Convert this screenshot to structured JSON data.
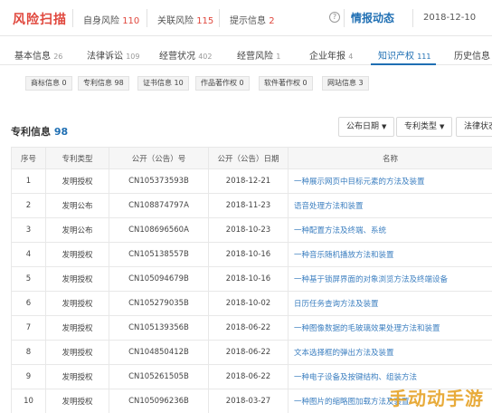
{
  "header": {
    "logo": "风险扫描",
    "self_risk_label": "自身风险",
    "self_risk_count": "110",
    "related_risk_label": "关联风险",
    "related_risk_count": "115",
    "hint_label": "提示信息",
    "hint_count": "2",
    "help_icon": "?",
    "news_label": "情报动态",
    "date": "2018-12-10"
  },
  "tabs": [
    {
      "label": "基本信息",
      "count": "26"
    },
    {
      "label": "法律诉讼",
      "count": "109"
    },
    {
      "label": "经营状况",
      "count": "402"
    },
    {
      "label": "经营风险",
      "count": "1"
    },
    {
      "label": "企业年报",
      "count": "4"
    },
    {
      "label": "知识产权",
      "count": "111"
    },
    {
      "label": "历史信息",
      "count": ""
    }
  ],
  "subtabs": [
    {
      "label": "商标信息 0"
    },
    {
      "label": "专利信息 98"
    },
    {
      "label": "证书信息 10"
    },
    {
      "label": "作品著作权 0"
    },
    {
      "label": "软件著作权 0"
    },
    {
      "label": "网站信息 3"
    }
  ],
  "section": {
    "title": "专利信息",
    "count": "98"
  },
  "filters": {
    "pub_date": "公布日期",
    "patent_type": "专利类型",
    "legal_status": "法律状态"
  },
  "table": {
    "headers": [
      "序号",
      "专利类型",
      "公开（公告）号",
      "公开（公告）日期",
      "名称"
    ],
    "rows": [
      [
        "1",
        "发明授权",
        "CN105373593B",
        "2018-12-21",
        "一种展示网页中目标元素的方法及装置"
      ],
      [
        "2",
        "发明公布",
        "CN108874797A",
        "2018-11-23",
        "语音处理方法和装置"
      ],
      [
        "3",
        "发明公布",
        "CN108696560A",
        "2018-10-23",
        "一种配置方法及终端、系统"
      ],
      [
        "4",
        "发明授权",
        "CN105138557B",
        "2018-10-16",
        "一种音乐随机播放方法和装置"
      ],
      [
        "5",
        "发明授权",
        "CN105094679B",
        "2018-10-16",
        "一种基于锁屏界面的对象浏览方法及终端设备"
      ],
      [
        "6",
        "发明授权",
        "CN105279035B",
        "2018-10-02",
        "日历任务查询方法及装置"
      ],
      [
        "7",
        "发明授权",
        "CN105139356B",
        "2018-06-22",
        "一种图像数据的毛玻璃效果处理方法和装置"
      ],
      [
        "8",
        "发明授权",
        "CN104850412B",
        "2018-06-22",
        "文本选择框的弹出方法及装置"
      ],
      [
        "9",
        "发明授权",
        "CN105261505B",
        "2018-06-22",
        "一种电子设备及按键结构、组装方法"
      ],
      [
        "10",
        "发明授权",
        "CN105096236B",
        "2018-03-27",
        "一种图片的缩略图加载方法及装置"
      ]
    ]
  },
  "watermark": "手动动手游",
  "colors": {
    "accent": "#1f6fb3",
    "danger": "#e0473d",
    "link": "#3c7fc0"
  }
}
